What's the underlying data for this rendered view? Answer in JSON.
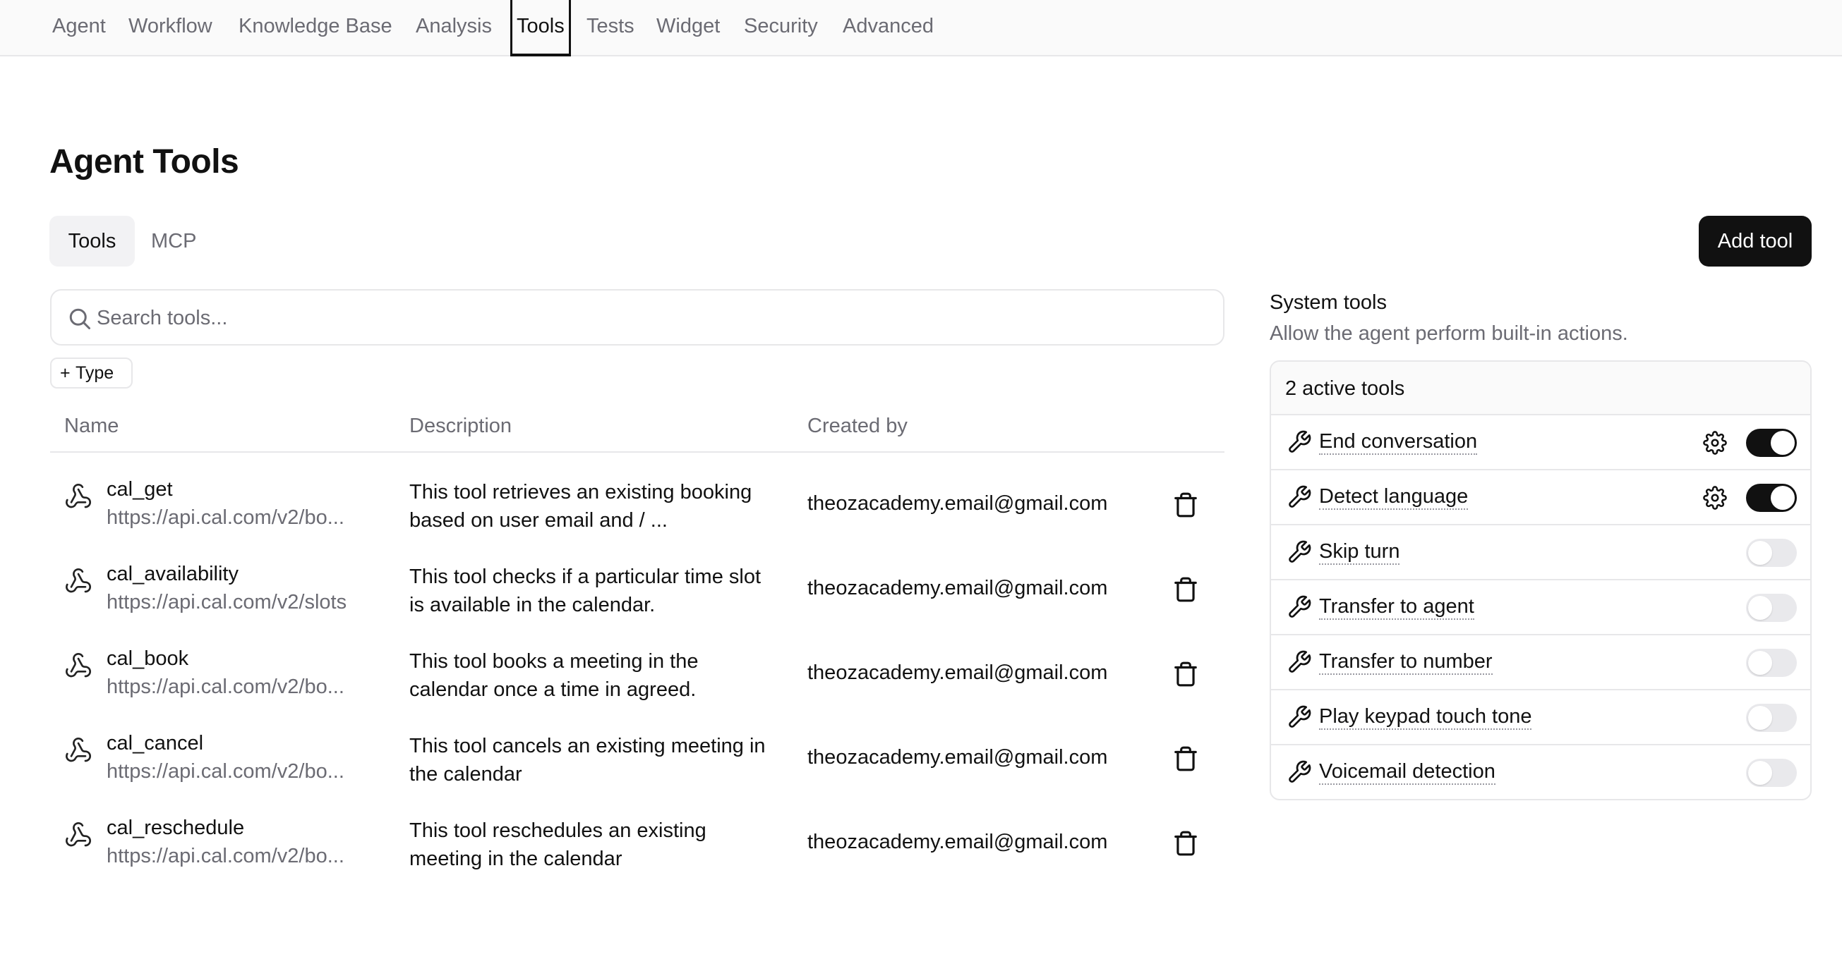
{
  "nav": {
    "tabs": [
      {
        "label": "Agent"
      },
      {
        "label": "Workflow"
      },
      {
        "label": "Knowledge Base"
      },
      {
        "label": "Analysis"
      },
      {
        "label": "Tools",
        "active": true
      },
      {
        "label": "Tests"
      },
      {
        "label": "Widget"
      },
      {
        "label": "Security"
      },
      {
        "label": "Advanced"
      }
    ]
  },
  "page": {
    "title": "Agent Tools",
    "subtabs": {
      "tools": "Tools",
      "mcp": "MCP"
    },
    "add_tool_label": "Add tool"
  },
  "search": {
    "placeholder": "Search tools...",
    "icon": "search-icon"
  },
  "filter": {
    "plus": "+",
    "label": "Type"
  },
  "table": {
    "headers": {
      "name": "Name",
      "description": "Description",
      "created_by": "Created by"
    },
    "rows": [
      {
        "name": "cal_get",
        "url": "https://api.cal.com/v2/bo...",
        "description": "This tool retrieves an existing booking based on user email and / ...",
        "created_by": "theozacademy.email@gmail.com"
      },
      {
        "name": "cal_availability",
        "url": "https://api.cal.com/v2/slots",
        "description": "This tool checks if a particular time slot is available in the calendar.",
        "created_by": "theozacademy.email@gmail.com"
      },
      {
        "name": "cal_book",
        "url": "https://api.cal.com/v2/bo...",
        "description": "This tool books a meeting in the calendar once a time in agreed.",
        "created_by": "theozacademy.email@gmail.com"
      },
      {
        "name": "cal_cancel",
        "url": "https://api.cal.com/v2/bo...",
        "description": "This tool cancels an existing meeting in the calendar",
        "created_by": "theozacademy.email@gmail.com"
      },
      {
        "name": "cal_reschedule",
        "url": "https://api.cal.com/v2/bo...",
        "description": "This tool reschedules an existing meeting in the calendar",
        "created_by": "theozacademy.email@gmail.com"
      }
    ]
  },
  "system_tools": {
    "title": "System tools",
    "subtitle": "Allow the agent perform built-in actions.",
    "active_count_label": "2 active tools",
    "items": [
      {
        "label": "End conversation",
        "enabled": true,
        "has_settings": true
      },
      {
        "label": "Detect language",
        "enabled": true,
        "has_settings": true
      },
      {
        "label": "Skip turn",
        "enabled": false,
        "has_settings": false
      },
      {
        "label": "Transfer to agent",
        "enabled": false,
        "has_settings": false
      },
      {
        "label": "Transfer to number",
        "enabled": false,
        "has_settings": false
      },
      {
        "label": "Play keypad touch tone",
        "enabled": false,
        "has_settings": false
      },
      {
        "label": "Voicemail detection",
        "enabled": false,
        "has_settings": false
      }
    ]
  },
  "colors": {
    "accent": "#111111",
    "muted_text": "#6b6b73",
    "border": "#e7e7e9",
    "nav_bg": "#fafafa"
  }
}
